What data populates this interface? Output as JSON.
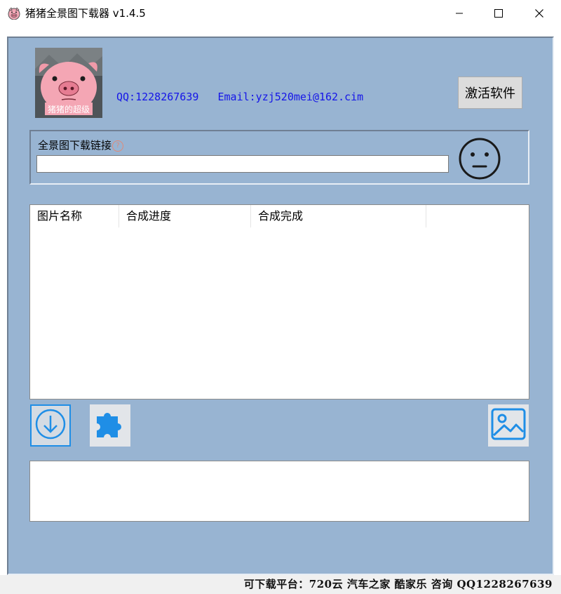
{
  "window": {
    "title": "猪猪全景图下载器  v1.4.5",
    "app_icon": "pig-icon",
    "controls": [
      "minimize-icon",
      "maximize-icon",
      "close-icon"
    ]
  },
  "header": {
    "logo_caption": "猪猪的超级",
    "contact": "QQ:1228267639   Email:yzj520mei@162.cim",
    "activate_label": "激活软件"
  },
  "url_section": {
    "label": "全景图下载链接",
    "help_glyph": "?",
    "value": "",
    "status_icon": "neutral-face-icon"
  },
  "task_list": {
    "columns": [
      "图片名称",
      "合成进度",
      "合成完成",
      ""
    ],
    "rows": []
  },
  "toolbar": {
    "download_icon": "download-arrow-icon",
    "plugin_icon": "puzzle-icon",
    "image_icon": "image-icon"
  },
  "log": {
    "text": ""
  },
  "status": {
    "text": "可下载平台：720云 汽车之家 酷家乐 咨询 QQ1228267639"
  },
  "colors": {
    "panel_bg": "#98b4d2",
    "contact_text": "#1515e8",
    "icon_blue": "#1f8ee6"
  }
}
